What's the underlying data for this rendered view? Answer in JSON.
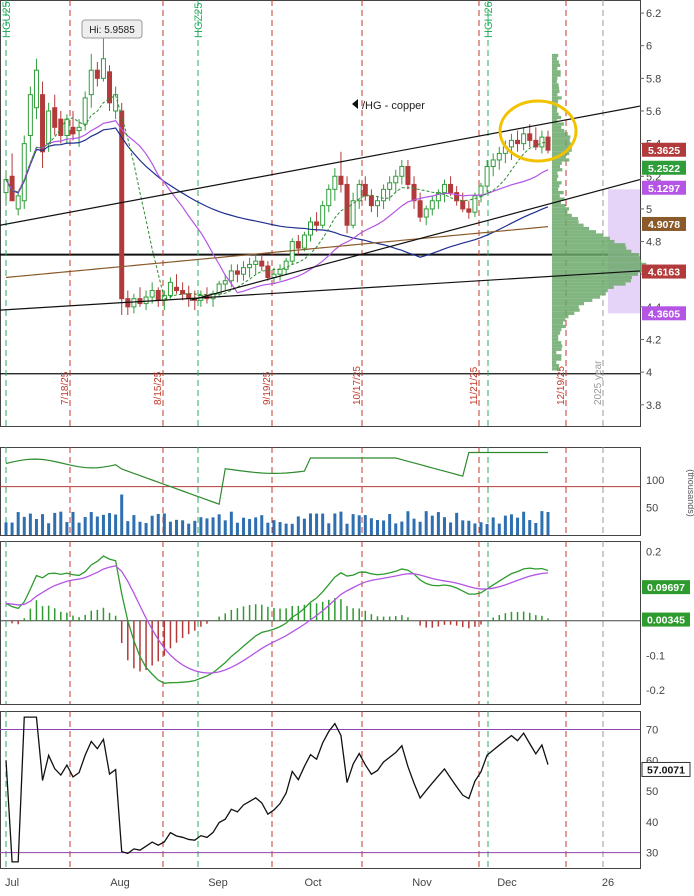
{
  "colors": {
    "up": "#2f9e3a",
    "down": "#b33a3a",
    "bg": "#ffffff",
    "frame": "#333333",
    "vline_red": "#c0392b",
    "vline_green": "#27ae60",
    "ma_green": "#2e8b2e",
    "ma_purple": "#b455e6",
    "ma_navy": "#1f2f8f",
    "ma_brown": "#8b5a2b",
    "vp_green": "#6aa86a",
    "vp_purple": "#e3cff7",
    "vol_bar": "#2e6fb0",
    "macd_green": "#2e9b2e",
    "macd_signal": "#b455e6",
    "rsi_line": "#111111"
  },
  "chart_data": [
    {
      "type": "candlestick",
      "title": "/HG - copper",
      "x_labels": [
        "Jul",
        "Aug",
        "Sep",
        "Oct",
        "Nov",
        "Dec",
        "26"
      ],
      "y_ticks": [
        3.8,
        4,
        4.2,
        4.4,
        4.6,
        4.8,
        5,
        5.2,
        5.4,
        5.6,
        5.8,
        6,
        6.2
      ],
      "y_tick_labels": [
        "3.8",
        "4",
        "4.2",
        "4.4",
        "4.6",
        "4.8",
        "5",
        "5.2",
        "5.4",
        "5.6",
        "5.8",
        "6",
        "6.2"
      ],
      "ylim": [
        3.67,
        6.28
      ],
      "high_label": "Hi: 5.9585",
      "high_value": 5.9585,
      "price_tags": [
        {
          "label": "5.3625",
          "value": 5.3625,
          "color": "#b33a3a"
        },
        {
          "label": "5.2522",
          "value": 5.2522,
          "color": "#2f9e3a"
        },
        {
          "label": "5.1297",
          "value": 5.1297,
          "color": "#b455e6"
        },
        {
          "label": "4.9078",
          "value": 4.9078,
          "color": "#8b5a2b"
        },
        {
          "label": "4.6163",
          "value": 4.6163,
          "color": "#b33a3a"
        },
        {
          "label": "4.3605",
          "value": 4.3605,
          "color": "#b455e6"
        }
      ],
      "vertical_markers": [
        {
          "label": "7/18/25",
          "color": "red"
        },
        {
          "label": "8/15/25",
          "color": "red"
        },
        {
          "label": "9/19/25",
          "color": "red"
        },
        {
          "label": "10/17/25",
          "color": "red"
        },
        {
          "label": "11/21/25",
          "color": "red"
        },
        {
          "label": "12/19/25",
          "color": "red"
        },
        {
          "label": "2025 year",
          "color": "gray"
        }
      ],
      "contract_markers": [
        {
          "label": "HGU25",
          "color": "green"
        },
        {
          "label": "HGZ25",
          "color": "green"
        },
        {
          "label": "HGH26",
          "color": "green"
        }
      ],
      "horizontal_levels": [
        4.72,
        3.99
      ],
      "candles": [
        [
          5.1,
          5.23,
          5.03,
          5.18
        ],
        [
          5.2,
          5.34,
          5.1,
          5.05
        ],
        [
          5.0,
          5.1,
          4.96,
          5.08
        ],
        [
          5.05,
          5.45,
          5.0,
          5.4
        ],
        [
          5.45,
          5.75,
          5.35,
          5.7
        ],
        [
          5.62,
          5.92,
          5.55,
          5.85
        ],
        [
          5.7,
          5.78,
          5.25,
          5.35
        ],
        [
          5.4,
          5.65,
          5.35,
          5.6
        ],
        [
          5.62,
          5.7,
          5.45,
          5.5
        ],
        [
          5.55,
          5.6,
          5.4,
          5.45
        ],
        [
          5.45,
          5.58,
          5.4,
          5.55
        ],
        [
          5.5,
          5.6,
          5.42,
          5.46
        ],
        [
          5.48,
          5.55,
          5.38,
          5.5
        ],
        [
          5.52,
          5.72,
          5.48,
          5.68
        ],
        [
          5.7,
          5.95,
          5.62,
          5.85
        ],
        [
          5.85,
          5.9,
          5.75,
          5.8
        ],
        [
          5.8,
          5.96,
          5.78,
          5.92
        ],
        [
          5.84,
          5.88,
          5.6,
          5.65
        ],
        [
          5.6,
          5.75,
          5.55,
          5.7
        ],
        [
          5.6,
          5.65,
          4.35,
          4.45
        ],
        [
          4.45,
          4.5,
          4.35,
          4.4
        ],
        [
          4.4,
          4.48,
          4.36,
          4.45
        ],
        [
          4.45,
          4.52,
          4.4,
          4.42
        ],
        [
          4.42,
          4.5,
          4.38,
          4.46
        ],
        [
          4.46,
          4.55,
          4.42,
          4.5
        ],
        [
          4.5,
          4.52,
          4.4,
          4.44
        ],
        [
          4.44,
          4.5,
          4.38,
          4.47
        ],
        [
          4.47,
          4.58,
          4.45,
          4.55
        ],
        [
          4.52,
          4.6,
          4.48,
          4.5
        ],
        [
          4.5,
          4.55,
          4.44,
          4.48
        ],
        [
          4.48,
          4.53,
          4.4,
          4.45
        ],
        [
          4.45,
          4.5,
          4.38,
          4.44
        ],
        [
          4.44,
          4.5,
          4.4,
          4.47
        ],
        [
          4.47,
          4.52,
          4.42,
          4.45
        ],
        [
          4.45,
          4.5,
          4.4,
          4.48
        ],
        [
          4.48,
          4.56,
          4.46,
          4.54
        ],
        [
          4.54,
          4.6,
          4.5,
          4.56
        ],
        [
          4.56,
          4.66,
          4.52,
          4.62
        ],
        [
          4.62,
          4.66,
          4.55,
          4.6
        ],
        [
          4.6,
          4.68,
          4.56,
          4.64
        ],
        [
          4.64,
          4.7,
          4.58,
          4.66
        ],
        [
          4.66,
          4.72,
          4.6,
          4.68
        ],
        [
          4.68,
          4.72,
          4.62,
          4.65
        ],
        [
          4.65,
          4.68,
          4.56,
          4.58
        ],
        [
          4.58,
          4.64,
          4.54,
          4.6
        ],
        [
          4.6,
          4.66,
          4.56,
          4.63
        ],
        [
          4.63,
          4.7,
          4.6,
          4.68
        ],
        [
          4.68,
          4.82,
          4.66,
          4.8
        ],
        [
          4.8,
          4.84,
          4.72,
          4.76
        ],
        [
          4.76,
          4.86,
          4.74,
          4.84
        ],
        [
          4.84,
          4.95,
          4.8,
          4.92
        ],
        [
          4.92,
          4.98,
          4.86,
          4.9
        ],
        [
          4.9,
          5.05,
          4.88,
          5.02
        ],
        [
          5.02,
          5.15,
          4.98,
          5.12
        ],
        [
          5.12,
          5.25,
          5.05,
          5.2
        ],
        [
          5.2,
          5.35,
          5.1,
          5.15
        ],
        [
          5.15,
          5.2,
          4.85,
          4.9
        ],
        [
          4.9,
          5.1,
          4.88,
          5.05
        ],
        [
          5.05,
          5.18,
          5.0,
          5.15
        ],
        [
          5.15,
          5.2,
          5.05,
          5.08
        ],
        [
          5.08,
          5.12,
          4.98,
          5.02
        ],
        [
          5.02,
          5.08,
          4.95,
          5.05
        ],
        [
          5.05,
          5.15,
          5.0,
          5.12
        ],
        [
          5.12,
          5.2,
          5.05,
          5.16
        ],
        [
          5.16,
          5.24,
          5.1,
          5.2
        ],
        [
          5.2,
          5.3,
          5.15,
          5.26
        ],
        [
          5.26,
          5.3,
          5.12,
          5.15
        ],
        [
          5.15,
          5.2,
          5.0,
          5.05
        ],
        [
          5.05,
          5.1,
          4.92,
          4.95
        ],
        [
          4.95,
          5.02,
          4.9,
          5.0
        ],
        [
          5.0,
          5.08,
          4.96,
          5.05
        ],
        [
          5.05,
          5.12,
          5.0,
          5.1
        ],
        [
          5.1,
          5.18,
          5.04,
          5.15
        ],
        [
          5.15,
          5.2,
          5.08,
          5.1
        ],
        [
          5.1,
          5.14,
          5.02,
          5.05
        ],
        [
          5.05,
          5.1,
          4.98,
          5.0
        ],
        [
          5.0,
          5.05,
          4.94,
          4.98
        ],
        [
          4.98,
          5.1,
          4.95,
          5.08
        ],
        [
          5.08,
          5.16,
          5.04,
          5.14
        ],
        [
          5.14,
          5.3,
          5.1,
          5.26
        ],
        [
          5.26,
          5.34,
          5.2,
          5.3
        ],
        [
          5.3,
          5.38,
          5.24,
          5.34
        ],
        [
          5.34,
          5.42,
          5.28,
          5.38
        ],
        [
          5.38,
          5.46,
          5.3,
          5.42
        ],
        [
          5.42,
          5.48,
          5.35,
          5.4
        ],
        [
          5.4,
          5.5,
          5.36,
          5.46
        ],
        [
          5.46,
          5.52,
          5.38,
          5.42
        ],
        [
          5.42,
          5.5,
          5.36,
          5.38
        ],
        [
          5.38,
          5.48,
          5.34,
          5.44
        ],
        [
          5.44,
          5.48,
          5.34,
          5.36
        ]
      ],
      "volume_profile_center": 4.66
    },
    {
      "type": "bar",
      "panel": "volume",
      "y_ticks": [
        50,
        100
      ],
      "y_tick_labels": [
        "50",
        "100"
      ],
      "ylim": [
        0,
        160
      ],
      "axis_label": "(thousands)"
    },
    {
      "type": "line",
      "panel": "macd",
      "y_ticks": [
        -0.2,
        -0.1,
        0,
        0.1,
        0.2
      ],
      "y_tick_labels": [
        "-0.2",
        "-0.1",
        "0",
        "0.1",
        "0.2"
      ],
      "ylim": [
        -0.24,
        0.23
      ],
      "value_tags": [
        {
          "label": "0.09697",
          "value": 0.09697,
          "color": "#2e9b2e"
        },
        {
          "label": "0.00345",
          "value": 0.00345,
          "color": "#2e9b2e"
        }
      ]
    },
    {
      "type": "line",
      "panel": "rsi",
      "y_ticks": [
        30,
        40,
        50,
        60,
        70
      ],
      "y_tick_labels": [
        "30",
        "40",
        "50",
        "60",
        "70"
      ],
      "ylim": [
        25,
        76
      ],
      "value_tags": [
        {
          "label": "57.0071",
          "value": 57.0071,
          "color": "#111111"
        }
      ],
      "levels": [
        70,
        30
      ]
    }
  ]
}
